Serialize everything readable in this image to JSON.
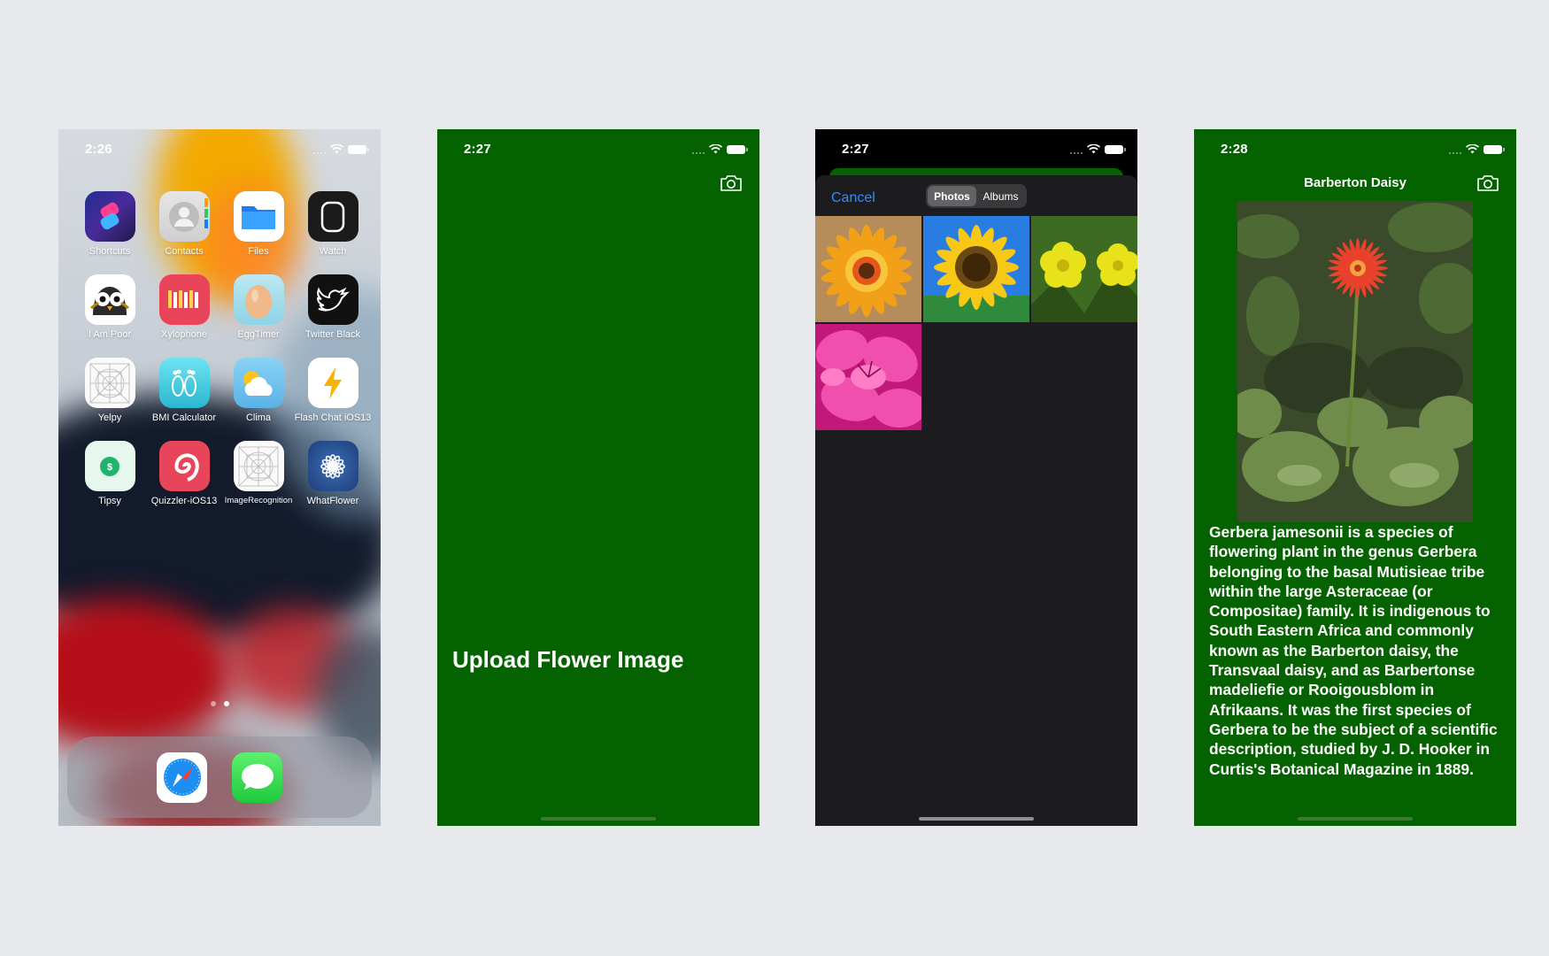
{
  "phones": {
    "home": {
      "time": "2:26",
      "apps": [
        {
          "label": "Shortcuts",
          "icon": "shortcuts-icon"
        },
        {
          "label": "Contacts",
          "icon": "contacts-icon"
        },
        {
          "label": "Files",
          "icon": "files-icon"
        },
        {
          "label": "Watch",
          "icon": "watch-icon"
        },
        {
          "label": "I Am Poor",
          "icon": "owl-icon"
        },
        {
          "label": "Xylophone",
          "icon": "xylophone-icon"
        },
        {
          "label": "EggTimer",
          "icon": "egg-icon"
        },
        {
          "label": "Twitter Black",
          "icon": "bird-icon"
        },
        {
          "label": "Yelpy",
          "icon": "app-grid-placeholder-icon"
        },
        {
          "label": "BMI Calculator",
          "icon": "footprints-icon"
        },
        {
          "label": "Clima",
          "icon": "weather-icon"
        },
        {
          "label": "Flash Chat iOS13",
          "icon": "lightning-icon"
        },
        {
          "label": "Tipsy",
          "icon": "money-icon"
        },
        {
          "label": "Quizzler-iOS13",
          "icon": "spiral-icon"
        },
        {
          "label": "ImageRecognition",
          "icon": "app-grid-placeholder-icon"
        },
        {
          "label": "WhatFlower",
          "icon": "flower-icon"
        }
      ],
      "dock": [
        {
          "name": "Safari",
          "icon": "compass-icon"
        },
        {
          "name": "Messages",
          "icon": "message-bubble-icon"
        }
      ]
    },
    "upload": {
      "time": "2:27",
      "title": "Upload Flower Image",
      "camera_icon": "camera-icon"
    },
    "picker": {
      "time": "2:27",
      "cancel_label": "Cancel",
      "segments": [
        "Photos",
        "Albums"
      ],
      "selected_segment": "Photos",
      "photos": [
        "orange-daisy",
        "sunflower",
        "yellow-buttercups",
        "pink-azalea"
      ]
    },
    "result": {
      "time": "2:28",
      "title": "Barberton Daisy",
      "description": "Gerbera jamesonii is a species of flowering plant in the genus Gerbera belonging to the basal Mutisieae tribe within the large Asteraceae (or Compositae) family. It is indigenous to South Eastern Africa and commonly known as the Barberton daisy, the Transvaal daisy, and as Barbertonse madeliefie or Rooigousblom in Afrikaans. It was the first species of Gerbera to be the subject of a scientific description, studied by J. D. Hooker in Curtis's Botanical Magazine in 1889.",
      "camera_icon": "camera-icon"
    }
  },
  "colors": {
    "app_green": "#056200",
    "picker_bg": "#1c1c1e",
    "link_blue": "#2f8cff",
    "canvas_bg": "#e8e9ec"
  }
}
